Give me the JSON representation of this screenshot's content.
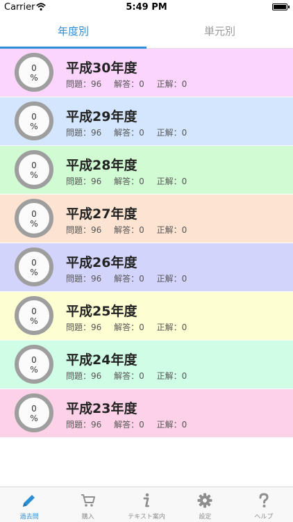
{
  "status_bar": {
    "carrier": "Carrier",
    "time": "5:49 PM"
  },
  "tabs": [
    {
      "label": "年度別",
      "active": true
    },
    {
      "label": "単元別",
      "active": false
    }
  ],
  "rows": [
    {
      "title": "平成30年度",
      "percent_num": "0",
      "percent_sign": "%",
      "questions": "問題：96",
      "answers": "解答：0",
      "correct": "正解：0",
      "color": "#fcd5fd"
    },
    {
      "title": "平成29年度",
      "percent_num": "0",
      "percent_sign": "%",
      "questions": "問題：96",
      "answers": "解答：0",
      "correct": "正解：0",
      "color": "#d3e6fe"
    },
    {
      "title": "平成28年度",
      "percent_num": "0",
      "percent_sign": "%",
      "questions": "問題：96",
      "answers": "解答：0",
      "correct": "正解：0",
      "color": "#d1fcd3"
    },
    {
      "title": "平成27年度",
      "percent_num": "0",
      "percent_sign": "%",
      "questions": "問題：96",
      "answers": "解答：0",
      "correct": "正解：0",
      "color": "#fde3d1"
    },
    {
      "title": "平成26年度",
      "percent_num": "0",
      "percent_sign": "%",
      "questions": "問題：96",
      "answers": "解答：0",
      "correct": "正解：0",
      "color": "#d3d4fc"
    },
    {
      "title": "平成25年度",
      "percent_num": "0",
      "percent_sign": "%",
      "questions": "問題：96",
      "answers": "解答：0",
      "correct": "正解：0",
      "color": "#fefed3"
    },
    {
      "title": "平成24年度",
      "percent_num": "0",
      "percent_sign": "%",
      "questions": "問題：96",
      "answers": "解答：0",
      "correct": "正解：0",
      "color": "#d0fde6"
    },
    {
      "title": "平成23年度",
      "percent_num": "0",
      "percent_sign": "%",
      "questions": "問題：96",
      "answers": "解答：0",
      "correct": "正解：0",
      "color": "#fdd1e7"
    }
  ],
  "bottom_nav": [
    {
      "label": "過去問",
      "icon": "pencil-icon",
      "active": true
    },
    {
      "label": "購入",
      "icon": "cart-icon",
      "active": false
    },
    {
      "label": "テキスト案内",
      "icon": "info-icon",
      "active": false
    },
    {
      "label": "設定",
      "icon": "gear-icon",
      "active": false
    },
    {
      "label": "ヘルプ",
      "icon": "question-icon",
      "active": false
    }
  ],
  "colors": {
    "accent": "#2d8cd6",
    "ring": "#9e9e9e",
    "inactive": "#8e8e8e"
  }
}
